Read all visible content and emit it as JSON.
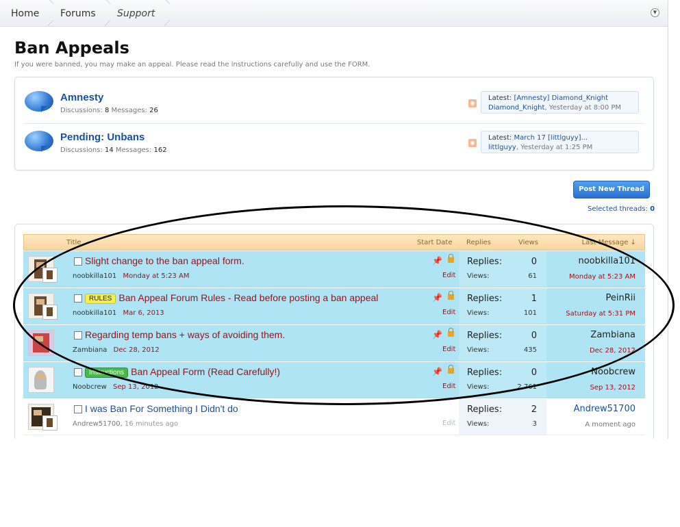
{
  "breadcrumb": {
    "home": "Home",
    "forums": "Forums",
    "support": "Support",
    "jump_icon": "chevron-down-circle-icon"
  },
  "forum": {
    "title": "Ban Appeals",
    "description": "If you were banned, you may make an appeal. Please read the instructions carefully and use the FORM."
  },
  "subforums": [
    {
      "title": "Amnesty",
      "discussions_label": "Discussions:",
      "discussions": "8",
      "messages_label": "Messages:",
      "messages": "26",
      "latest_label": "Latest:",
      "latest_title": "[Amnesty] Diamond_Knight",
      "latest_user": "Diamond_Knight",
      "latest_date": "Yesterday at 8:00 PM"
    },
    {
      "title": "Pending: Unbans",
      "discussions_label": "Discussions:",
      "discussions": "14",
      "messages_label": "Messages:",
      "messages": "162",
      "latest_label": "Latest:",
      "latest_title": "March 17 [littlguyy]...",
      "latest_user": "littlguyy",
      "latest_date": "Yesterday at 1:25 PM"
    }
  ],
  "actions": {
    "post_new_thread": "Post New Thread",
    "selected_threads_label": "Selected threads:",
    "selected_threads_count": "0"
  },
  "list_header": {
    "title": "Title",
    "start_date": "Start Date",
    "replies": "Replies",
    "views": "Views",
    "last_message": "Last Message ↓"
  },
  "labels": {
    "replies": "Replies:",
    "views": "Views:",
    "edit": "Edit"
  },
  "threads": [
    {
      "prefix": "",
      "title": "Slight change to the ban appeal form.",
      "author": "noobkilla101",
      "date": "Monday at 5:23 AM",
      "replies": "0",
      "views": "61",
      "last_user": "noobkilla101",
      "last_date": "Monday at 5:23 AM"
    },
    {
      "prefix": "RULES",
      "title": "Ban Appeal Forum Rules - Read before posting a ban appeal",
      "author": "noobkilla101",
      "date": "Mar 6, 2013",
      "replies": "1",
      "views": "101",
      "last_user": "PeinRii",
      "last_date": "Saturday at 5:31 PM"
    },
    {
      "prefix": "",
      "title": "Regarding temp bans + ways of avoiding them.",
      "author": "Zambiana",
      "date": "Dec 28, 2012",
      "replies": "0",
      "views": "435",
      "last_user": "Zambiana",
      "last_date": "Dec 28, 2012"
    },
    {
      "prefix": "Instructions",
      "title": "Ban Appeal Form (Read Carefully!)",
      "author": "Noobcrew",
      "date": "Sep 13, 2012",
      "replies": "0",
      "views": "2,761",
      "last_user": "Noobcrew",
      "last_date": "Sep 13, 2012"
    },
    {
      "prefix": "",
      "title": "I was Ban For Something I Didn't do",
      "author": "Andrew51700",
      "date": "16 minutes ago",
      "replies": "2",
      "views": "3",
      "last_user": "Andrew51700",
      "last_date": "A moment ago"
    }
  ]
}
